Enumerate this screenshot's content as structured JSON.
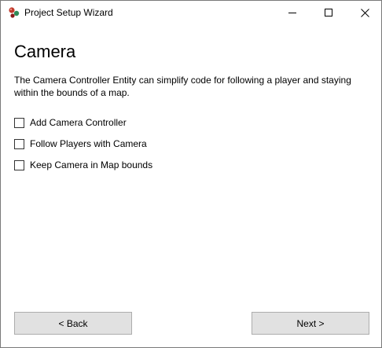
{
  "window": {
    "title": "Project Setup Wizard",
    "icon": "app-icon"
  },
  "page": {
    "heading": "Camera",
    "description": "The Camera Controller Entity can simplify code for following a player and staying within the bounds of a map."
  },
  "options": [
    {
      "label": "Add Camera Controller",
      "checked": false
    },
    {
      "label": "Follow Players with Camera",
      "checked": false
    },
    {
      "label": "Keep Camera in Map bounds",
      "checked": false
    }
  ],
  "buttons": {
    "back_label": "< Back",
    "next_label": "Next >"
  },
  "colors": {
    "button_bg": "#e1e1e1",
    "button_border": "#adadad",
    "window_border": "#7a7a7a"
  }
}
